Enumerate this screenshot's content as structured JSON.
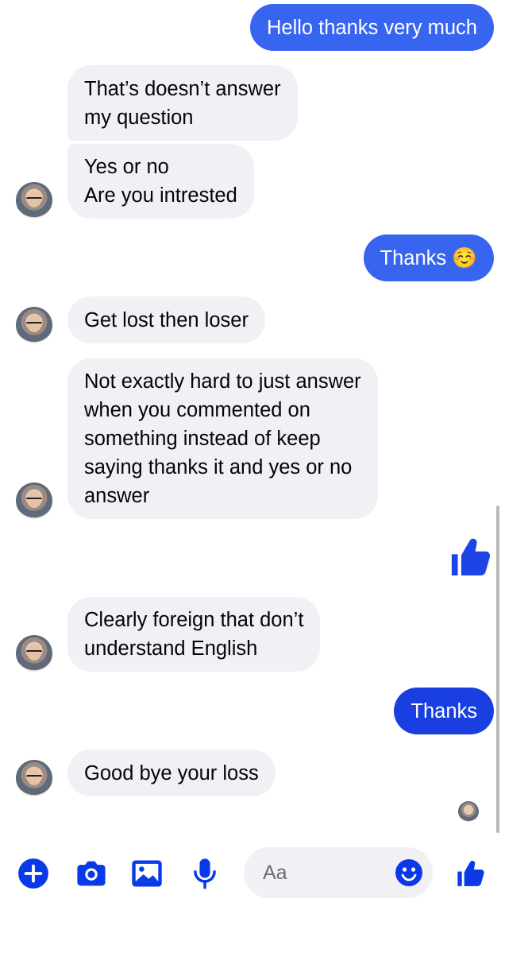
{
  "colors": {
    "accent": "#0a3ae8",
    "incoming_bubble": "#f0f0f5",
    "outgoing_gradient": [
      "#3865f0",
      "#2d5af0",
      "#1a3fe0"
    ]
  },
  "messages": [
    {
      "direction": "outgoing",
      "lines": [
        "Hello thanks very much"
      ]
    },
    {
      "direction": "incoming",
      "lines": [
        "That’s doesn’t answer",
        "my question"
      ]
    },
    {
      "direction": "incoming",
      "lines": [
        "Yes or no",
        "Are you intrested"
      ]
    },
    {
      "direction": "outgoing",
      "lines": [
        "Thanks ☺️"
      ]
    },
    {
      "direction": "incoming",
      "lines": [
        "Get lost then loser"
      ]
    },
    {
      "direction": "incoming",
      "lines": [
        "Not exactly hard to just answer",
        "when you commented on",
        "something instead of keep",
        "saying thanks it and yes or no",
        "answer"
      ]
    },
    {
      "direction": "outgoing",
      "type": "like",
      "icon": "thumbs-up-icon"
    },
    {
      "direction": "incoming",
      "lines": [
        "Clearly foreign that don’t",
        "understand English"
      ]
    },
    {
      "direction": "outgoing",
      "lines": [
        "Thanks"
      ]
    },
    {
      "direction": "incoming",
      "lines": [
        "Good bye your loss"
      ]
    }
  ],
  "composer": {
    "placeholder": "Aa",
    "icons": [
      "plus-icon",
      "camera-icon",
      "photo-icon",
      "microphone-icon",
      "emoji-icon",
      "thumbs-up-icon"
    ]
  }
}
